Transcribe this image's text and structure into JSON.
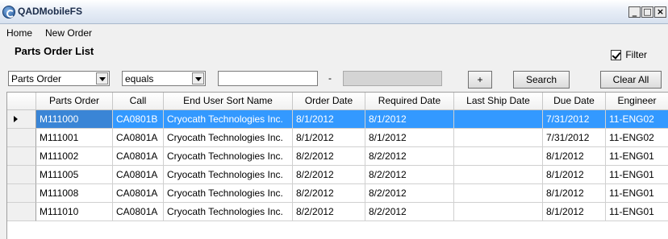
{
  "window": {
    "title": "QADMobileFS",
    "minimize": "_",
    "maximize": "□",
    "close": "×"
  },
  "menu": [
    "Home",
    "New Order"
  ],
  "page_title": "Parts Order List",
  "filter_toggle": {
    "label": "Filter",
    "checked": true
  },
  "filterbar": {
    "field_select": "Parts Order",
    "operator_select": "equals",
    "value_input": "",
    "range_separator": "-",
    "range_input": "",
    "add_label": "+",
    "search_label": "Search",
    "clear_label": "Clear All"
  },
  "grid": {
    "columns": [
      "Parts Order",
      "Call",
      "End User Sort Name",
      "Order Date",
      "Required Date",
      "Last Ship Date",
      "Due Date",
      "Engineer"
    ],
    "rows": [
      [
        "M111000",
        "CA0801B",
        "Cryocath Technologies Inc.",
        "8/1/2012",
        "8/1/2012",
        "",
        "7/31/2012",
        "11-ENG02"
      ],
      [
        "M111001",
        "CA0801A",
        "Cryocath Technologies Inc.",
        "8/1/2012",
        "8/1/2012",
        "",
        "7/31/2012",
        "11-ENG02"
      ],
      [
        "M111002",
        "CA0801A",
        "Cryocath Technologies Inc.",
        "8/2/2012",
        "8/2/2012",
        "",
        "8/1/2012",
        "11-ENG01"
      ],
      [
        "M111005",
        "CA0801A",
        "Cryocath Technologies Inc.",
        "8/2/2012",
        "8/2/2012",
        "",
        "8/1/2012",
        "11-ENG01"
      ],
      [
        "M111008",
        "CA0801A",
        "Cryocath Technologies Inc.",
        "8/2/2012",
        "8/2/2012",
        "",
        "8/1/2012",
        "11-ENG01"
      ],
      [
        "M111010",
        "CA0801A",
        "Cryocath Technologies Inc.",
        "8/2/2012",
        "8/2/2012",
        "",
        "8/1/2012",
        "11-ENG01"
      ]
    ],
    "selected_row": 0
  },
  "colors": {
    "selection": "#3399ff",
    "selection_cell": "#3a85d6"
  }
}
